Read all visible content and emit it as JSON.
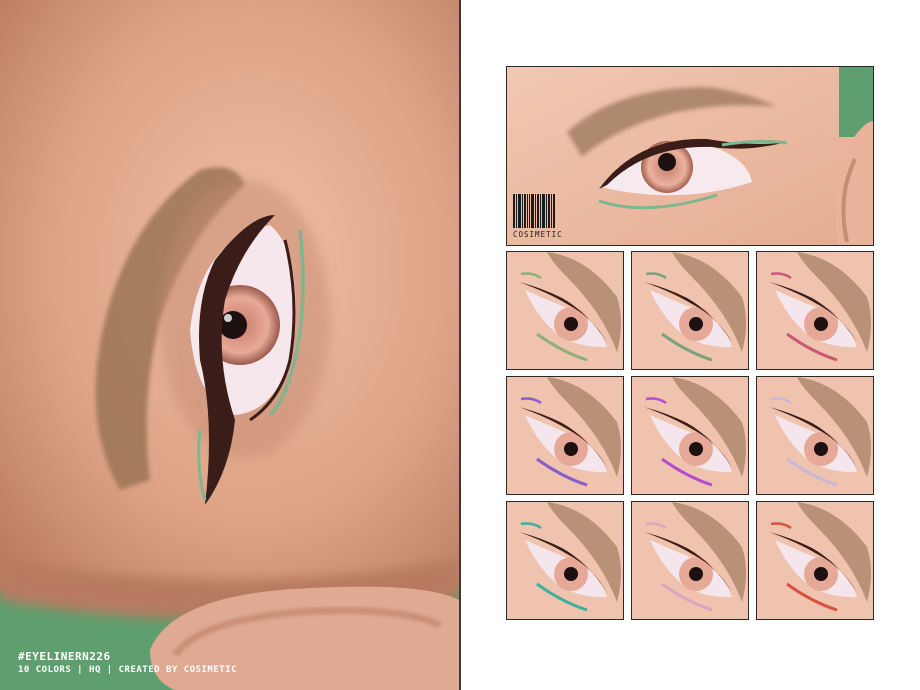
{
  "caption": {
    "title": "#EYELINERN226",
    "subtitle": "10 COLORS | HQ | CREATED BY COSIMETIC"
  },
  "preview": {
    "barcode_text": "COSIMETIC",
    "liner_color": "#7fb58f",
    "background_color": "#5f9e6e"
  },
  "swatches": [
    {
      "color": "#8fae7a"
    },
    {
      "color": "#7aa07e"
    },
    {
      "color": "#c95878"
    },
    {
      "color": "#8a5cc8"
    },
    {
      "color": "#b04fd0"
    },
    {
      "color": "#c8b8d8"
    },
    {
      "color": "#3fb0a0"
    },
    {
      "color": "#d8a8c0"
    },
    {
      "color": "#d85040"
    }
  ]
}
